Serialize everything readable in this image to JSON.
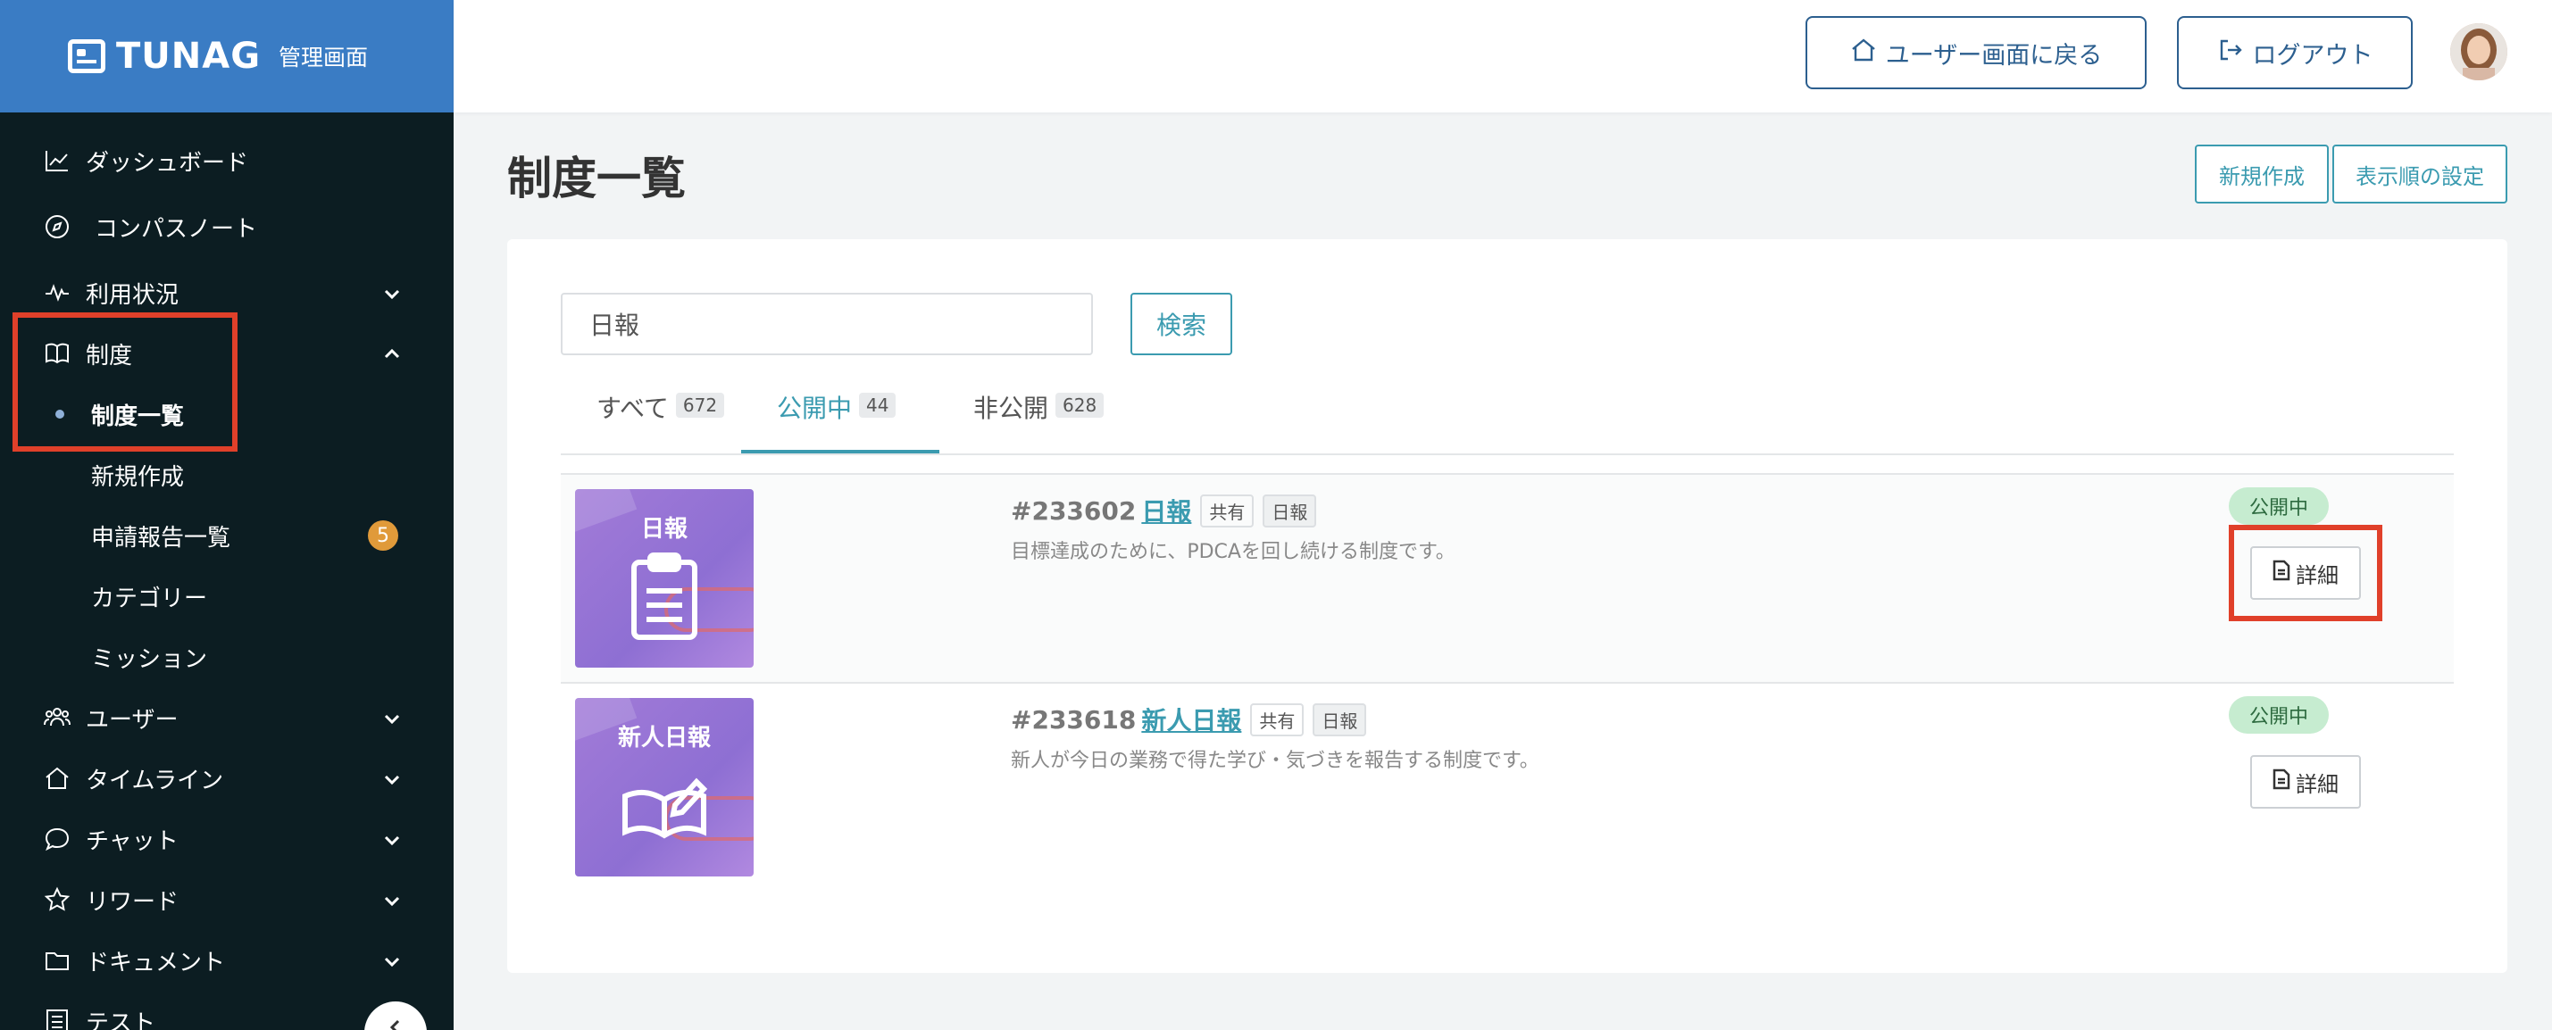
{
  "brand": {
    "name": "TUNAG",
    "subtitle": "管理画面"
  },
  "sidebar": {
    "items": [
      {
        "label": "ダッシュボード",
        "icon": "chart-line-icon"
      },
      {
        "label": "コンパスノート",
        "icon": "compass-icon"
      },
      {
        "label": "利用状況",
        "icon": "pulse-icon",
        "expandable": true
      },
      {
        "label": "制度",
        "icon": "book-icon",
        "expanded": true
      },
      {
        "label": "制度一覧",
        "sub": true,
        "active": true
      },
      {
        "label": "新規作成",
        "sub": true
      },
      {
        "label": "申請報告一覧",
        "sub": true,
        "badge": "5"
      },
      {
        "label": "カテゴリー",
        "sub": true
      },
      {
        "label": "ミッション",
        "sub": true
      },
      {
        "label": "ユーザー",
        "icon": "users-icon",
        "expandable": true
      },
      {
        "label": "タイムライン",
        "icon": "home-icon",
        "expandable": true
      },
      {
        "label": "チャット",
        "icon": "chat-icon",
        "expandable": true
      },
      {
        "label": "リワード",
        "icon": "star-icon",
        "expandable": true
      },
      {
        "label": "ドキュメント",
        "icon": "folder-icon",
        "expandable": true
      },
      {
        "label": "テスト",
        "icon": "list-icon"
      }
    ]
  },
  "header": {
    "back_label": "ユーザー画面に戻る",
    "logout_label": "ログアウト"
  },
  "main": {
    "title": "制度一覧",
    "new_label": "新規作成",
    "order_label": "表示順の設定",
    "search": {
      "value": "日報",
      "button": "検索"
    },
    "tabs": [
      {
        "label": "すべて",
        "count": "672"
      },
      {
        "label": "公開中",
        "count": "44",
        "active": true
      },
      {
        "label": "非公開",
        "count": "628"
      }
    ],
    "rows": [
      {
        "thumb_title": "日報",
        "id": "#233602",
        "name": "日報",
        "tags": [
          "共有",
          "日報"
        ],
        "desc": "目標達成のために、PDCAを回し続ける制度です。",
        "status": "公開中",
        "detail": "詳細"
      },
      {
        "thumb_title": "新人日報",
        "id": "#233618",
        "name": "新人日報",
        "tags": [
          "共有",
          "日報"
        ],
        "desc": "新人が今日の業務で得た学び・気づきを報告する制度です。",
        "status": "公開中",
        "detail": "詳細"
      }
    ]
  },
  "colors": {
    "brand": "#3a7cc4",
    "sidebar": "#0c1d22",
    "accent": "#3b9bb0",
    "highlight": "#e0402a"
  }
}
